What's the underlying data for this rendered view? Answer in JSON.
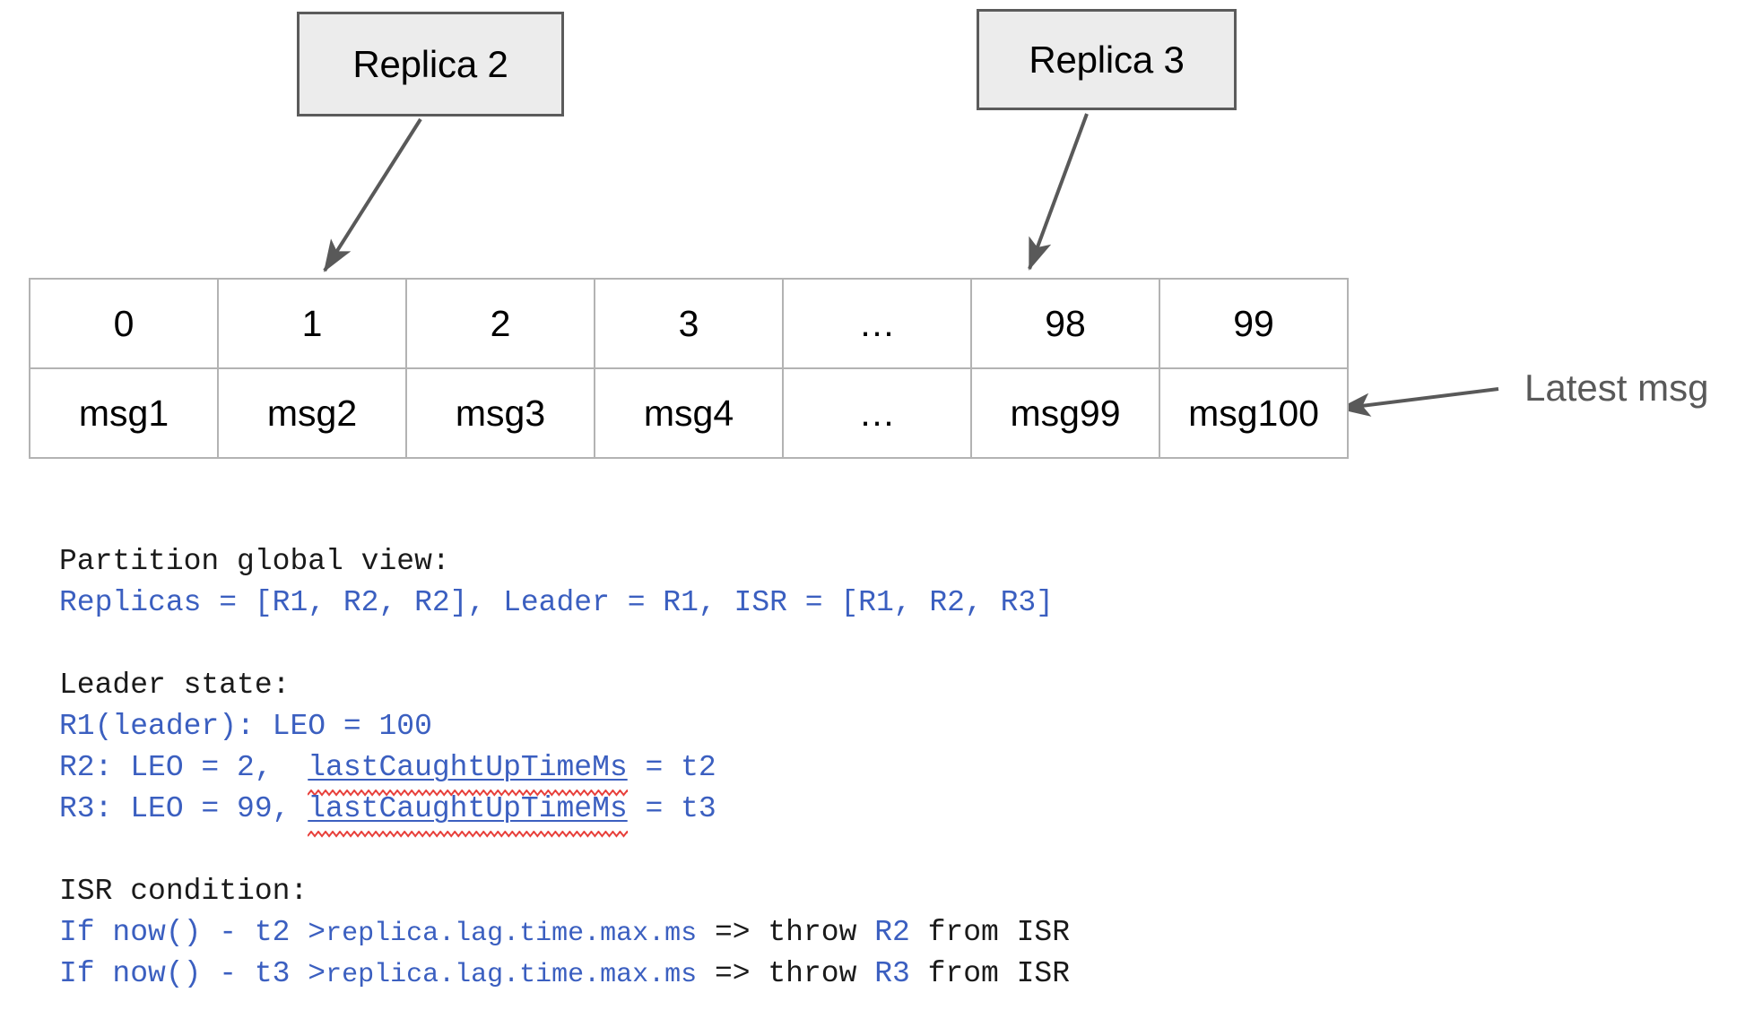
{
  "diagram": {
    "title": "Kafka partition replica ISR diagram",
    "callouts": [
      {
        "id": "replica2",
        "label": "Replica 2",
        "points_to_offset": "1"
      },
      {
        "id": "replica3",
        "label": "Replica 3",
        "points_to_offset": "98"
      }
    ],
    "annotation": {
      "latest_msg_label": "Latest msg"
    },
    "colors": {
      "box_fill": "#ececec",
      "box_border": "#5b5b5b",
      "table_border": "#b3b3b3",
      "arrow": "#595959",
      "code_blue": "#3b5fc0",
      "code_black": "#1a1a1a",
      "spellcheck_red": "#e8413c"
    }
  },
  "log_table": {
    "offsets_row": [
      "0",
      "1",
      "2",
      "3",
      "…",
      "98",
      "99"
    ],
    "messages_row": [
      "msg1",
      "msg2",
      "msg3",
      "msg4",
      "…",
      "msg99",
      "msg100"
    ]
  },
  "code": {
    "lines": [
      {
        "id": "partition-global-view-heading",
        "tokens": [
          {
            "text": "Partition global view:",
            "color": "black"
          }
        ]
      },
      {
        "id": "replicas-line",
        "tokens": [
          {
            "text": "Replicas = [R1, R2, R2], Leader = R1, ISR = [R1, R2, R3]",
            "color": "blue"
          }
        ]
      },
      {
        "id": "blank-1",
        "tokens": []
      },
      {
        "id": "leader-state-heading",
        "tokens": [
          {
            "text": "Leader state:",
            "color": "black"
          }
        ]
      },
      {
        "id": "r1-leader-leo",
        "tokens": [
          {
            "text": "R1(leader): LEO = 100",
            "color": "blue"
          }
        ]
      },
      {
        "id": "r2-leo",
        "tokens": [
          {
            "text": "R2: LEO = 2,  ",
            "color": "blue"
          },
          {
            "text": "lastCaughtUpTimeMs",
            "color": "blue",
            "underline": true,
            "spellcheck": true
          },
          {
            "text": " = t2",
            "color": "blue"
          }
        ]
      },
      {
        "id": "r3-leo",
        "tokens": [
          {
            "text": "R3: LEO = 99, ",
            "color": "blue"
          },
          {
            "text": "lastCaughtUpTimeMs",
            "color": "blue",
            "underline": true,
            "spellcheck": true
          },
          {
            "text": " = t3",
            "color": "blue"
          }
        ]
      },
      {
        "id": "blank-2",
        "tokens": []
      },
      {
        "id": "isr-condition-heading",
        "tokens": [
          {
            "text": "ISR condition:",
            "color": "black"
          }
        ]
      },
      {
        "id": "isr-condition-r2",
        "tokens": [
          {
            "text": "If now() - t2 >",
            "color": "blue"
          },
          {
            "text": "replica.lag.time.max.ms",
            "color": "blue",
            "small": true
          },
          {
            "text": " => throw ",
            "color": "black"
          },
          {
            "text": "R2",
            "color": "blue"
          },
          {
            "text": " from ISR",
            "color": "black"
          }
        ]
      },
      {
        "id": "isr-condition-r3",
        "tokens": [
          {
            "text": "If now() - t3 >",
            "color": "blue"
          },
          {
            "text": "replica.lag.time.max.ms",
            "color": "blue",
            "small": true
          },
          {
            "text": " => throw ",
            "color": "black"
          },
          {
            "text": "R3",
            "color": "blue"
          },
          {
            "text": " from ISR",
            "color": "black"
          }
        ]
      }
    ]
  }
}
